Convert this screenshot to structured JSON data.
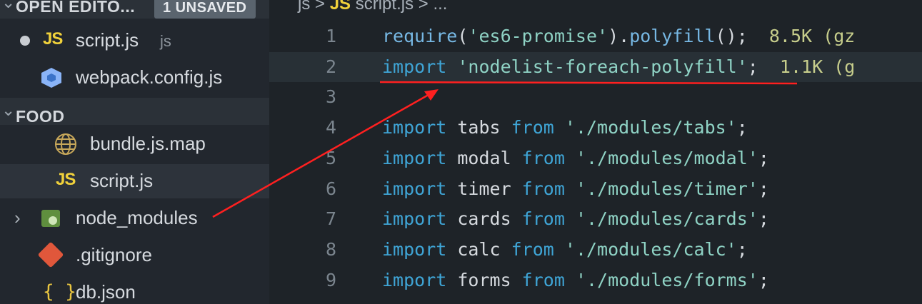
{
  "sidebar": {
    "open_editors": {
      "title": "OPEN EDITO...",
      "badge": "1 UNSAVED"
    },
    "open_files": [
      {
        "icon": "JS",
        "name": "script.js",
        "detail": "js"
      },
      {
        "icon": "webpack-icon",
        "name": "webpack.config.js"
      }
    ],
    "folder": {
      "title": "FOOD"
    },
    "tree": [
      {
        "icon": "globe-js-icon",
        "name": "bundle.js.map"
      },
      {
        "icon": "JS",
        "name": "script.js"
      },
      {
        "icon": "node-modules-folder-icon",
        "name": "node_modules"
      },
      {
        "icon": "git-icon",
        "name": ".gitignore"
      },
      {
        "icon": "{ }",
        "name": "db.json"
      }
    ]
  },
  "editor": {
    "breadcrumb": {
      "folder": "js",
      "sep": ">",
      "icon": "JS",
      "file": "script.js",
      "more": "..."
    },
    "lines": [
      {
        "n": "1",
        "tokens": [
          [
            "fn",
            "require"
          ],
          [
            "punc",
            "("
          ],
          [
            "str",
            "'es6-promise'"
          ],
          [
            "punc",
            ")."
          ],
          [
            "fn",
            "polyfill"
          ],
          [
            "punc",
            "();"
          ],
          [
            "size",
            "  8.5K (gz"
          ]
        ]
      },
      {
        "n": "2",
        "tokens": [
          [
            "kw",
            "import"
          ],
          [
            "id",
            " "
          ],
          [
            "str",
            "'nodelist-foreach-polyfill'"
          ],
          [
            "punc",
            ";"
          ],
          [
            "size",
            "  1.1K (g"
          ]
        ]
      },
      {
        "n": "3",
        "tokens": []
      },
      {
        "n": "4",
        "tokens": [
          [
            "kw",
            "import"
          ],
          [
            "id",
            " tabs "
          ],
          [
            "kw",
            "from"
          ],
          [
            "id",
            " "
          ],
          [
            "str",
            "'./modules/tabs'"
          ],
          [
            "punc",
            ";"
          ]
        ]
      },
      {
        "n": "5",
        "tokens": [
          [
            "kw",
            "import"
          ],
          [
            "id",
            " modal "
          ],
          [
            "kw",
            "from"
          ],
          [
            "id",
            " "
          ],
          [
            "str",
            "'./modules/modal'"
          ],
          [
            "punc",
            ";"
          ]
        ]
      },
      {
        "n": "6",
        "tokens": [
          [
            "kw",
            "import"
          ],
          [
            "id",
            " timer "
          ],
          [
            "kw",
            "from"
          ],
          [
            "id",
            " "
          ],
          [
            "str",
            "'./modules/timer'"
          ],
          [
            "punc",
            ";"
          ]
        ]
      },
      {
        "n": "7",
        "tokens": [
          [
            "kw",
            "import"
          ],
          [
            "id",
            " cards "
          ],
          [
            "kw",
            "from"
          ],
          [
            "id",
            " "
          ],
          [
            "str",
            "'./modules/cards'"
          ],
          [
            "punc",
            ";"
          ]
        ]
      },
      {
        "n": "8",
        "tokens": [
          [
            "kw",
            "import"
          ],
          [
            "id",
            " calc "
          ],
          [
            "kw",
            "from"
          ],
          [
            "id",
            " "
          ],
          [
            "str",
            "'./modules/calc'"
          ],
          [
            "punc",
            ";"
          ]
        ]
      },
      {
        "n": "9",
        "tokens": [
          [
            "kw",
            "import"
          ],
          [
            "id",
            " forms "
          ],
          [
            "kw",
            "from"
          ],
          [
            "id",
            " "
          ],
          [
            "str",
            "'./modules/forms'"
          ],
          [
            "punc",
            ";"
          ]
        ]
      }
    ]
  },
  "colors": {
    "annotation": "#ff2020",
    "js_yellow": "#f0d13b"
  }
}
